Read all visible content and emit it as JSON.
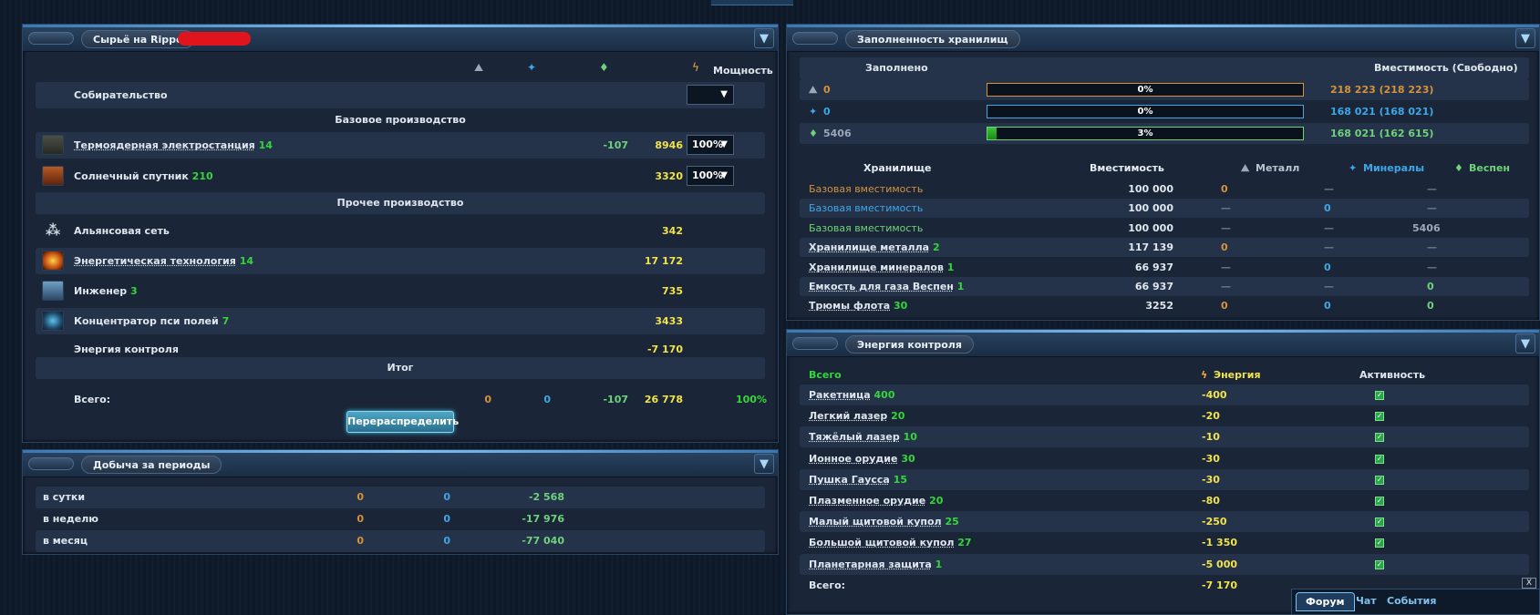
{
  "raw": {
    "title": "Сырьё на Rippe",
    "power_header": "Мощность",
    "gather": "Собирательство",
    "section_base": "Базовое производство",
    "section_other": "Прочее производство",
    "section_total": "Итог",
    "rows": [
      {
        "name": "Термоядерная электростанция",
        "level": "14",
        "metal": "",
        "crystal": "",
        "deut": "-107",
        "energy": "8946",
        "pct": "100%"
      },
      {
        "name": "Солнечный спутник",
        "level": "210",
        "metal": "",
        "crystal": "",
        "deut": "",
        "energy": "3320",
        "pct": "100%"
      },
      {
        "name": "Альянсовая сеть",
        "level": "",
        "energy": "342"
      },
      {
        "name": "Энергетическая технология",
        "level": "14",
        "energy": "17 172"
      },
      {
        "name": "Инженер",
        "level": "3",
        "energy": "735"
      },
      {
        "name": "Концентратор пси полей",
        "level": "7",
        "energy": "3433"
      },
      {
        "name": "Энергия контроля",
        "level": "",
        "energy": "-7 170"
      }
    ],
    "total": {
      "label": "Всего:",
      "metal": "0",
      "crystal": "0",
      "deut": "-107",
      "energy": "26 778",
      "pct": "100%"
    },
    "button": "Перераспределить"
  },
  "periods": {
    "title": "Добыча за периоды",
    "rows": [
      {
        "label": "в сутки",
        "metal": "0",
        "crystal": "0",
        "deut": "-2 568"
      },
      {
        "label": "в неделю",
        "metal": "0",
        "crystal": "0",
        "deut": "-17 976"
      },
      {
        "label": "в месяц",
        "metal": "0",
        "crystal": "0",
        "deut": "-77 040"
      }
    ]
  },
  "storage": {
    "title": "Заполненность хранилищ",
    "filled_header": "Заполнено",
    "capacity_header": "Вместимость (Свободно)",
    "bars": [
      {
        "amount": "0",
        "pct": 0,
        "pct_label": "0%",
        "capacity": "218 223 (218 223)",
        "color": "#d4923a"
      },
      {
        "amount": "0",
        "pct": 0,
        "pct_label": "0%",
        "capacity": "168 021 (168 021)",
        "color": "#3fa6e8"
      },
      {
        "amount": "5406",
        "pct": 3,
        "pct_label": "3%",
        "capacity": "168 021 (162 615)",
        "color": "#6fd27a"
      }
    ],
    "head": {
      "name": "Хранилище",
      "cap": "Вместимость",
      "metal": "Металл",
      "crystal": "Минералы",
      "deut": "Веспен"
    },
    "rows": [
      {
        "name": "Базовая вместимость",
        "level": "",
        "cap": "100 000",
        "metal": "0",
        "crystal": "—",
        "deut": "—",
        "cls": "orange"
      },
      {
        "name": "Базовая вместимость",
        "level": "",
        "cap": "100 000",
        "metal": "—",
        "crystal": "0",
        "deut": "—",
        "cls": "blue"
      },
      {
        "name": "Базовая вместимость",
        "level": "",
        "cap": "100 000",
        "metal": "—",
        "crystal": "—",
        "deut": "5406",
        "cls": "green"
      },
      {
        "name": "Хранилище металла",
        "level": "2",
        "cap": "117 139",
        "metal": "0",
        "crystal": "—",
        "deut": "—",
        "cls": "white"
      },
      {
        "name": "Хранилище минералов",
        "level": "1",
        "cap": "66 937",
        "metal": "—",
        "crystal": "0",
        "deut": "—",
        "cls": "white"
      },
      {
        "name": "Емкость для газа Веспен",
        "level": "1",
        "cap": "66 937",
        "metal": "—",
        "crystal": "—",
        "deut": "0",
        "cls": "white"
      },
      {
        "name": "Трюмы флота",
        "level": "30",
        "cap": "3252",
        "metal": "0",
        "crystal": "0",
        "deut": "0",
        "cls": "white"
      }
    ]
  },
  "control": {
    "title": "Энергия контроля",
    "head": {
      "all": "Всего",
      "energy": "Энергия",
      "active": "Активность"
    },
    "rows": [
      {
        "name": "Ракетница",
        "level": "400",
        "energy": "-400"
      },
      {
        "name": "Легкий лазер",
        "level": "20",
        "energy": "-20"
      },
      {
        "name": "Тяжёлый лазер",
        "level": "10",
        "energy": "-10"
      },
      {
        "name": "Ионное орудие",
        "level": "30",
        "energy": "-30"
      },
      {
        "name": "Пушка Гаусса",
        "level": "15",
        "energy": "-30"
      },
      {
        "name": "Плазменное орудие",
        "level": "20",
        "energy": "-80"
      },
      {
        "name": "Малый щитовой купол",
        "level": "25",
        "energy": "-250"
      },
      {
        "name": "Большой щитовой купол",
        "level": "27",
        "energy": "-1 350"
      },
      {
        "name": "Планетарная защита",
        "level": "1",
        "energy": "-5 000"
      }
    ],
    "total": {
      "label": "Всего:",
      "energy": "-7 170"
    }
  },
  "tabs": [
    "Форум",
    "Чат",
    "События"
  ],
  "close_label": "X"
}
